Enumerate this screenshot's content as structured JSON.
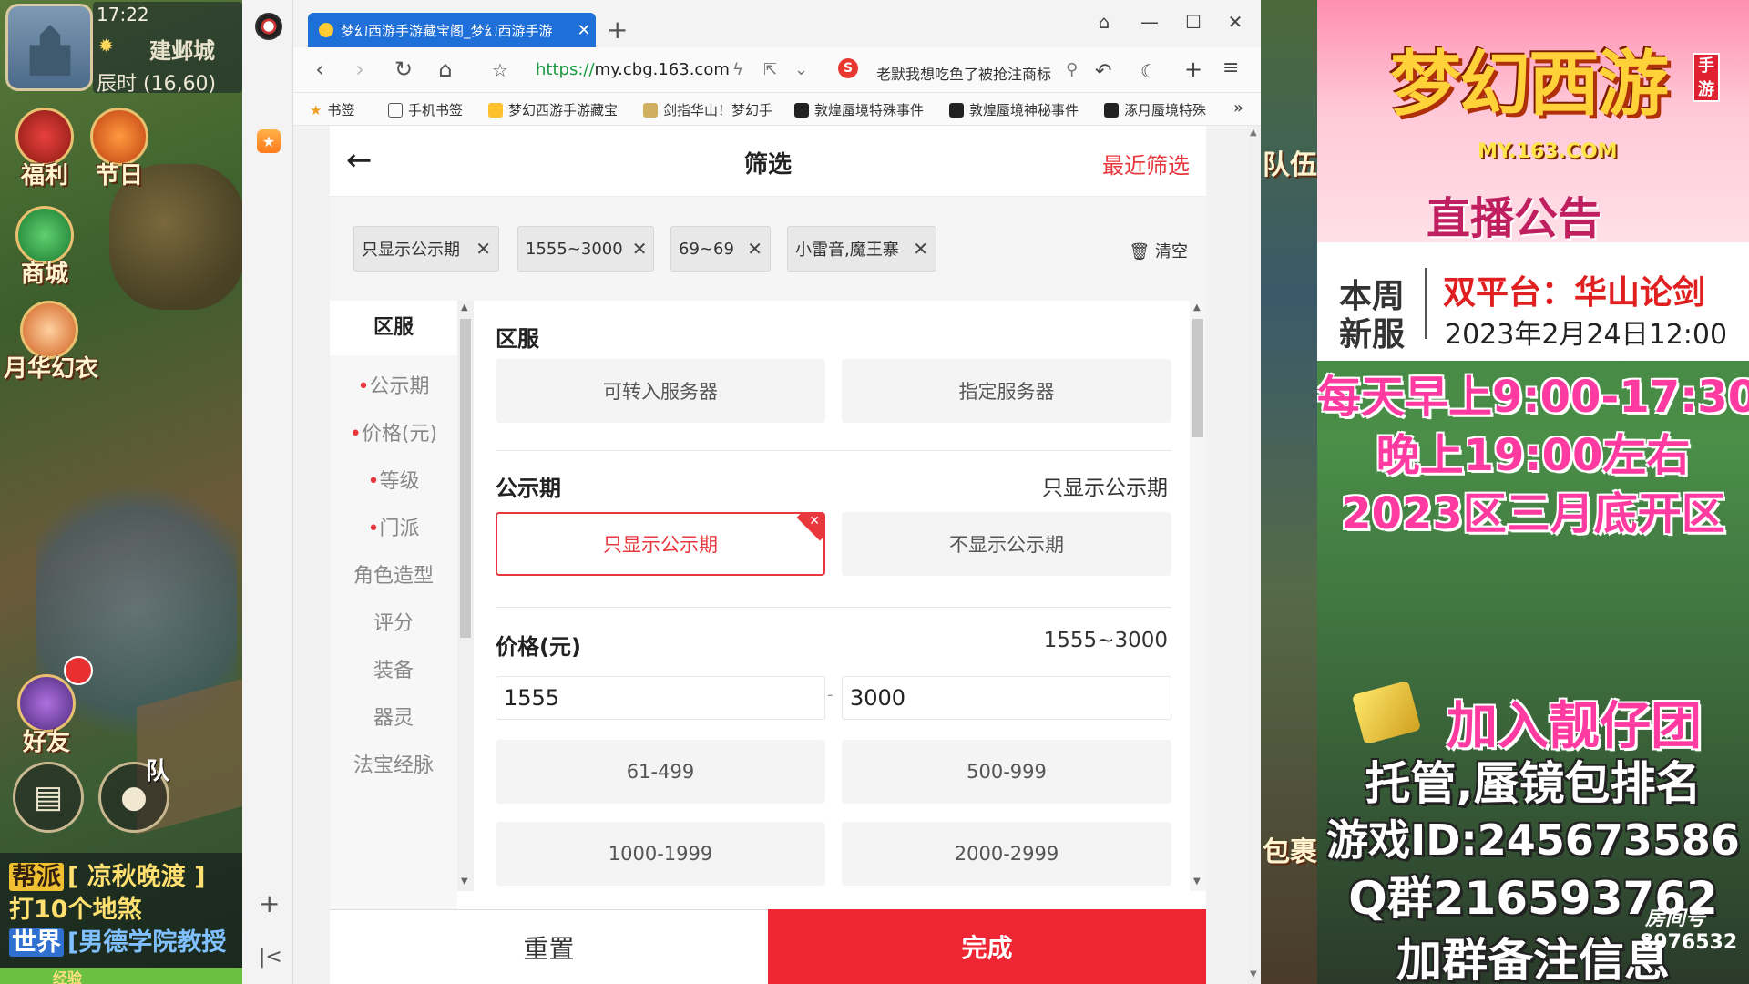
{
  "game": {
    "time": "17:22",
    "city": "建邺城",
    "coords": "辰时 (16,60)",
    "icons": [
      "福利",
      "节日",
      "商城",
      "月华幻衣",
      "好友"
    ],
    "team": "队",
    "chat": [
      {
        "tag": "帮派",
        "text": "[ 凉秋晚渡 ]"
      },
      {
        "tag": "",
        "text": "打10个地煞"
      },
      {
        "tag": "世界",
        "text": "[男德学院教授"
      }
    ],
    "exp_label": "经验",
    "right_edge": [
      "队伍",
      "包裹"
    ]
  },
  "browser": {
    "tab_title": "梦幻西游手游藏宝阁_梦幻西游手游",
    "url_scheme": "https://",
    "url_host": "my.cbg.163.com",
    "search_text": "老默我想吃鱼了被抢注商标",
    "bookmarks": [
      "书签",
      "手机书签",
      "梦幻西游手游藏宝",
      "剑指华山！梦幻手",
      "敦煌蜃境特殊事件",
      "敦煌蜃境神秘事件",
      "涿月蜃境特殊"
    ]
  },
  "page": {
    "title": "筛选",
    "recent": "最近筛选",
    "chips": [
      "只显示公示期",
      "1555~3000",
      "69~69",
      "小雷音,魔王寨"
    ],
    "clear": "清空",
    "nav": [
      {
        "label": "区服",
        "dot": ""
      },
      {
        "label": "公示期",
        "dot": "•"
      },
      {
        "label": "价格(元)",
        "dot": "•"
      },
      {
        "label": "等级",
        "dot": "•"
      },
      {
        "label": "门派",
        "dot": "•"
      },
      {
        "label": "角色造型",
        "dot": ""
      },
      {
        "label": "评分",
        "dot": ""
      },
      {
        "label": "装备",
        "dot": ""
      },
      {
        "label": "器灵",
        "dot": ""
      },
      {
        "label": "法宝经脉",
        "dot": ""
      }
    ],
    "server": {
      "title": "区服",
      "options": [
        "可转入服务器",
        "指定服务器"
      ]
    },
    "notice": {
      "title": "公示期",
      "current": "只显示公示期",
      "options": [
        "只显示公示期",
        "不显示公示期"
      ]
    },
    "price": {
      "title": "价格(元)",
      "current": "1555~3000",
      "min": "1555",
      "max": "3000",
      "presets": [
        "61-499",
        "500-999",
        "1000-1999",
        "2000-2999"
      ]
    },
    "reset": "重置",
    "done": "完成"
  },
  "ad": {
    "logo": "梦幻西游",
    "logo_badge": "手游",
    "logo_url": "MY.163.COM",
    "live": "直播公告",
    "week_1": "本周",
    "week_2": "新服",
    "server_name": "双平台：华山论剑",
    "server_date": "2023年2月24日12:00",
    "lines": [
      "每天早上9:00-17:30",
      "晚上19:00左右",
      "2023区三月底开区",
      "加入靓仔团",
      "托管,蜃镜包排名",
      "游戏ID:245673586",
      "Q群216593762",
      "加群备注信息"
    ],
    "room_label": "房间号",
    "room_id": "8976532"
  },
  "colors": {
    "accent": "#e8383d",
    "done": "#ee2532",
    "tab": "#1f6fd8"
  }
}
